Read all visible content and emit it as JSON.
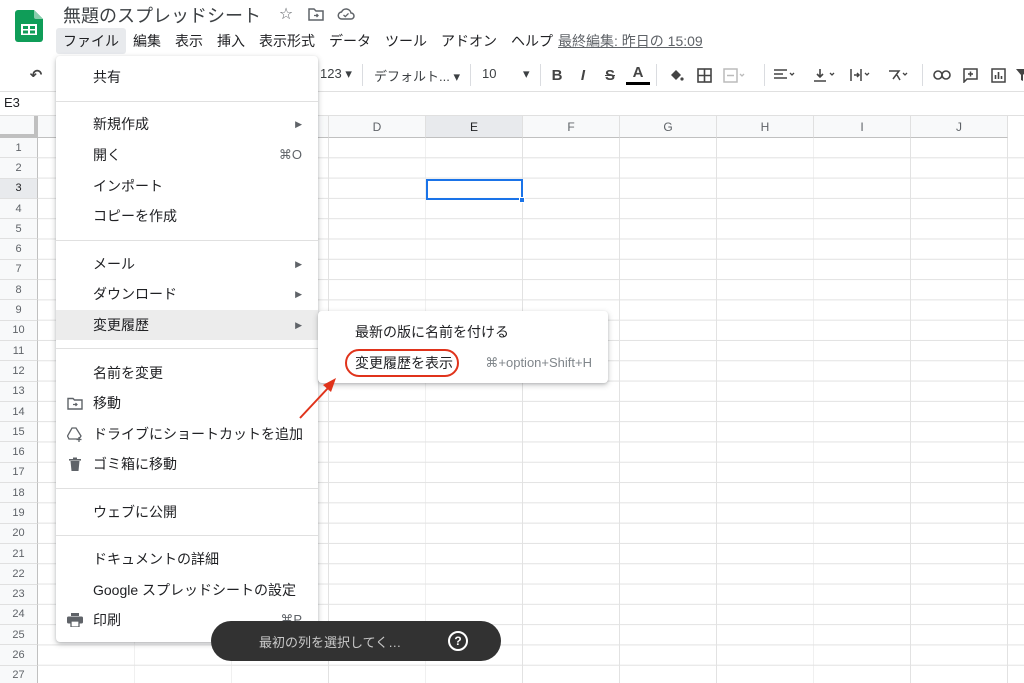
{
  "header": {
    "title": "無題のスプレッドシート",
    "last_edit": "最終編集: 昨日の 15:09",
    "menus": [
      "ファイル",
      "編集",
      "表示",
      "挿入",
      "表示形式",
      "データ",
      "ツール",
      "アドオン",
      "ヘルプ"
    ],
    "active_menu_index": 0
  },
  "toolbar": {
    "number_format": "123",
    "font": "デフォルト...",
    "font_size": "10",
    "bold": "B",
    "italic": "I",
    "strike": "S",
    "text_color": "A"
  },
  "name_box": "E3",
  "grid": {
    "columns": [
      "D",
      "E",
      "F",
      "G",
      "H",
      "I",
      "J"
    ],
    "selected_column": "E",
    "rows": [
      "1",
      "2",
      "3",
      "4",
      "5",
      "6",
      "7",
      "8",
      "9",
      "10",
      "11",
      "12",
      "13",
      "14",
      "15",
      "16",
      "17",
      "18",
      "19",
      "20",
      "21",
      "22",
      "23",
      "24",
      "25",
      "26",
      "27"
    ],
    "selected_row": "3"
  },
  "file_menu": {
    "share": "共有",
    "new": "新規作成",
    "open": "開く",
    "open_shortcut": "⌘O",
    "import": "インポート",
    "make_copy": "コピーを作成",
    "email": "メール",
    "download": "ダウンロード",
    "version_history": "変更履歴",
    "rename": "名前を変更",
    "move": "移動",
    "add_shortcut": "ドライブにショートカットを追加",
    "trash": "ゴミ箱に移動",
    "publish": "ウェブに公開",
    "details": "ドキュメントの詳細",
    "settings": "Google スプレッドシートの設定",
    "print": "印刷",
    "print_shortcut": "⌘P"
  },
  "version_submenu": {
    "name_version": "最新の版に名前を付ける",
    "see_history": "変更履歴を表示",
    "see_history_shortcut": "⌘+option+Shift+H"
  },
  "snackbar": {
    "text": "最初の列を選択してく…",
    "help": "?"
  },
  "colors": {
    "accent": "#1a73e8",
    "annotation": "#e0331b",
    "logo": "#0f9d58"
  }
}
